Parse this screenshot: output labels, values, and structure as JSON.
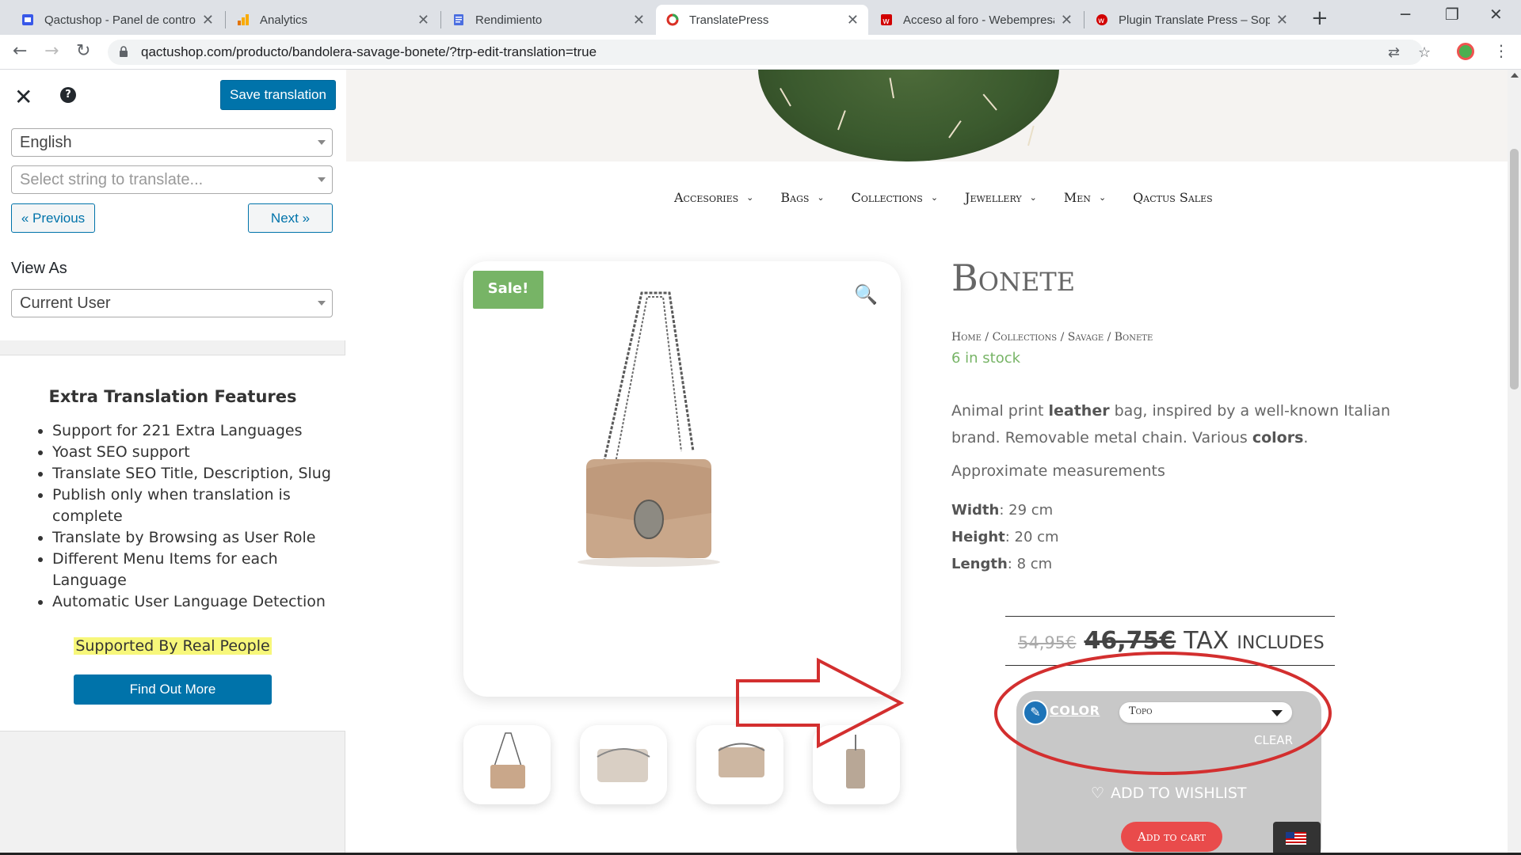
{
  "browser": {
    "tabs": [
      {
        "title": "Qactushop - Panel de control",
        "icon": "wordpress-icon",
        "color": "#3858e9"
      },
      {
        "title": "Analytics",
        "icon": "analytics-icon",
        "color": "#f9ab00"
      },
      {
        "title": "Rendimiento",
        "icon": "translate-doc-icon",
        "color": "#4b6ee0"
      },
      {
        "title": "TranslatePress",
        "icon": "translatepress-icon",
        "color": "#d93025"
      },
      {
        "title": "Acceso al foro - Webempresa",
        "icon": "webempresa-icon",
        "color": "#d10000"
      },
      {
        "title": "Plugin Translate Press – Sopo",
        "icon": "webempresa-icon",
        "color": "#d10000"
      }
    ],
    "active_tab": 3,
    "url": "qactushop.com/producto/bandolera-savage-bonete/?trp-edit-translation=true"
  },
  "sidebar": {
    "save_label": "Save translation",
    "language": "English",
    "string_placeholder": "Select string to translate...",
    "prev_label": "« Previous",
    "next_label": "Next »",
    "view_as_label": "View As",
    "view_as_value": "Current User",
    "extra_title": "Extra Translation Features",
    "features": [
      "Support for 221 Extra Languages",
      "Yoast SEO support",
      "Translate SEO Title, Description, Slug",
      "Publish only when translation is complete",
      "Translate by Browsing as User Role",
      "Different Menu Items for each Language",
      "Automatic User Language Detection"
    ],
    "supported_label": "Supported By Real People",
    "find_out_label": "Find Out More",
    "accent_color": "#0073aa"
  },
  "site": {
    "menu": [
      {
        "label": "Accesories",
        "has_children": true
      },
      {
        "label": "Bags",
        "has_children": true
      },
      {
        "label": "Collections",
        "has_children": true
      },
      {
        "label": "Jewellery",
        "has_children": true
      },
      {
        "label": "Men",
        "has_children": true
      },
      {
        "label": "Qactus Sales",
        "has_children": false
      }
    ],
    "sale_badge": "Sale!",
    "product": {
      "title": "Bonete",
      "breadcrumb": {
        "home": "Home",
        "collections": "Collections",
        "savage": "Savage",
        "current": "Bonete",
        "sep": " / "
      },
      "stock": "6 in stock",
      "desc_1": "Animal print ",
      "desc_bold_1": "leather",
      "desc_2": " bag, inspired by a well-known Italian brand. Removable metal chain. Various ",
      "desc_bold_2": "colors",
      "desc_3": ".",
      "approx": "Approximate measurements",
      "width_label": "Width",
      "width_value": ": 29 cm",
      "height_label": "Height",
      "height_value": ": 20 cm",
      "length_label": "Length",
      "length_value": ": 8 cm",
      "old_price": "54,95€",
      "new_price": "46,75€",
      "tax_label": "TAX",
      "includes_label": "INCLUDES",
      "color_label": "COLOR",
      "color_value": "Topo",
      "clear_label": "CLEAR",
      "wishlist_label": "ADD TO WISHLIST",
      "cart_label": "Add to cart"
    },
    "sale_color": "#77b466",
    "cart_color": "#e94b4b",
    "annotation_color": "#d32f2f"
  }
}
